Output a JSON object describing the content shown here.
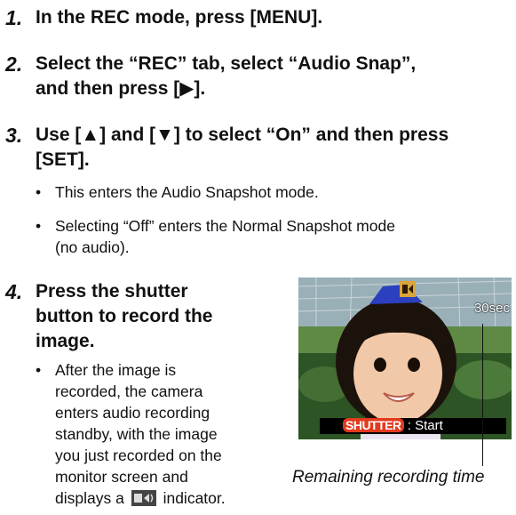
{
  "steps": [
    {
      "num": "1.",
      "text": "In the REC mode, press [MENU]."
    },
    {
      "num": "2.",
      "text_line1": "Select the “REC” tab, select “Audio Snap”,",
      "text_line2": "and then press [▶]."
    },
    {
      "num": "3.",
      "text_line1": "Use [▲] and [▼] to select “On” and then press",
      "text_line2": "[SET]."
    },
    {
      "num": "4.",
      "text_line1": "Press the shutter",
      "text_line2": "button to record the",
      "text_line3": "image."
    }
  ],
  "bullets_step3": [
    {
      "line1": "This enters the Audio Snapshot mode."
    },
    {
      "line1": "Selecting “Off” enters the Normal Snapshot mode",
      "line2": "(no audio)."
    }
  ],
  "bullet_step4": {
    "line1": "After the image is",
    "line2": "recorded, the camera",
    "line3": "enters audio recording",
    "line4": "standby, with the image",
    "line5": "you just recorded on the",
    "line6": "monitor screen and",
    "line7_pre": "displays a",
    "line7_post": "indicator."
  },
  "screen": {
    "remaining_time": "30sec",
    "shutter_key": "SHUTTER",
    "shutter_action": " : Start"
  },
  "caption": "Remaining recording time",
  "bullet_char": "•",
  "icons": {
    "audio_snapshot": "audio-snapshot-indicator-icon"
  }
}
